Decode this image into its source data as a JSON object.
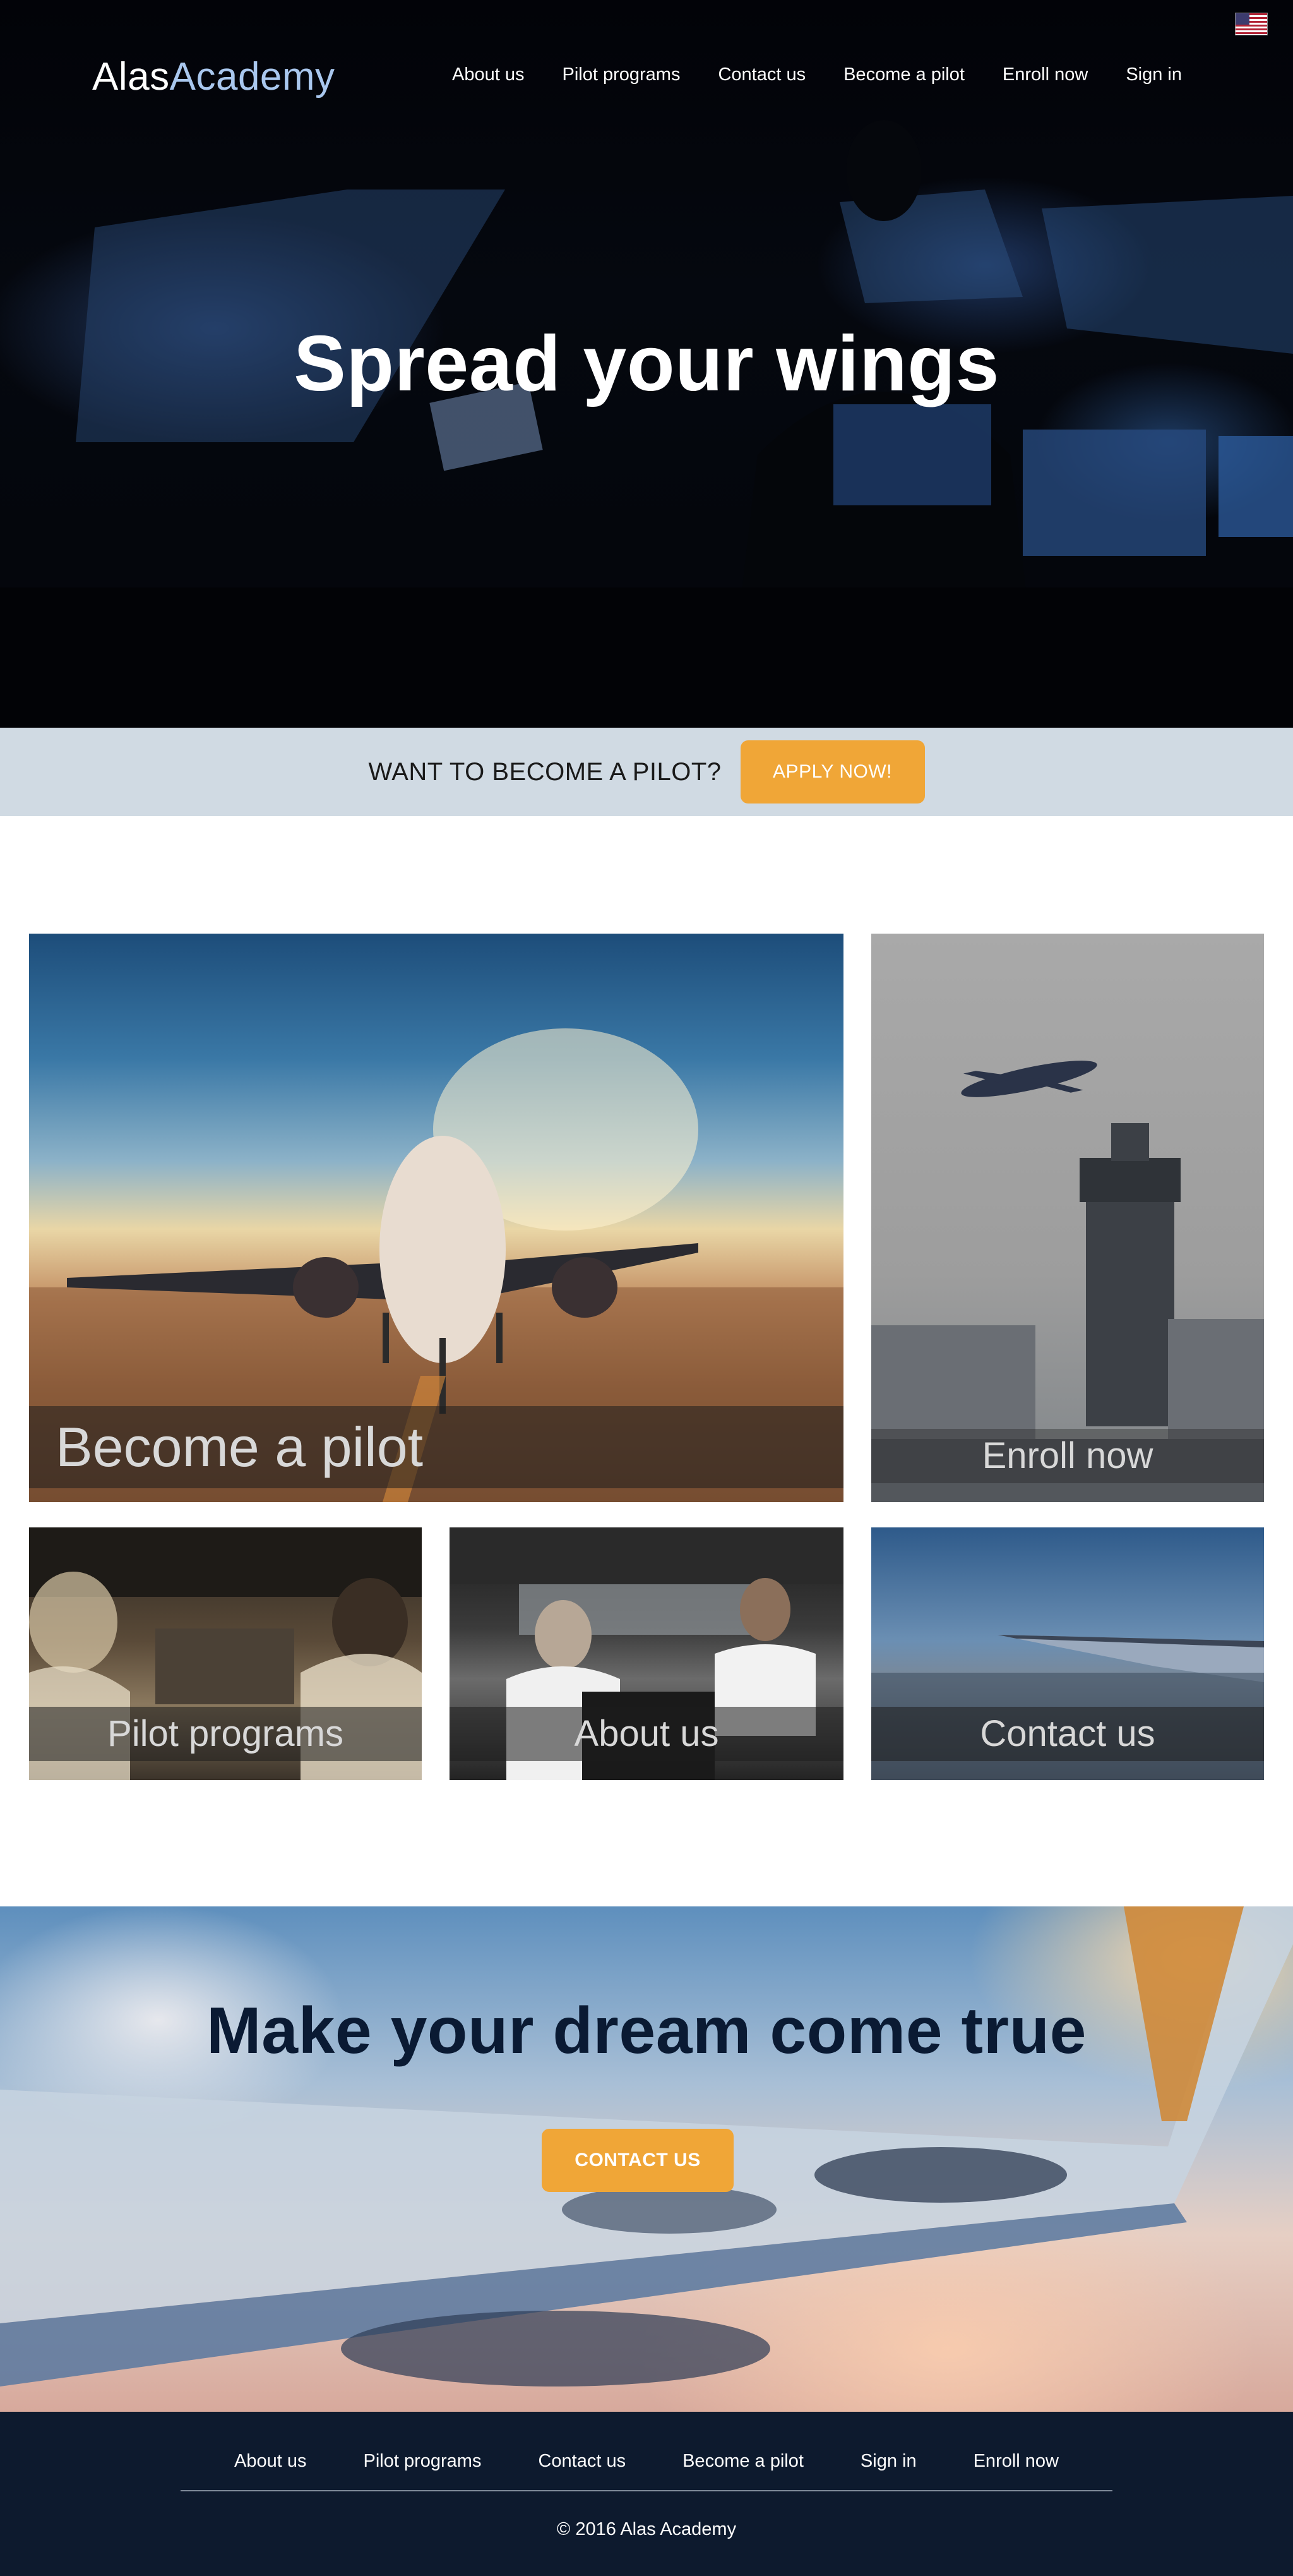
{
  "header": {
    "logo_part1": "Alas",
    "logo_part2": "Academy",
    "nav": [
      "About us",
      "Pilot programs",
      "Contact us",
      "Become a pilot",
      "Enroll now",
      "Sign in"
    ]
  },
  "hero": {
    "title": "Spread your wings"
  },
  "cta": {
    "text": "WANT TO BECOME A PILOT?",
    "button": "APPLY NOW!"
  },
  "tiles": {
    "become": "Become a pilot",
    "enroll": "Enroll now",
    "pilot_programs": "Pilot programs",
    "about": "About us",
    "contact": "Contact us"
  },
  "dream": {
    "title": "Make your dream come true",
    "button": "CONTACT US"
  },
  "footer": {
    "nav": [
      "About us",
      "Pilot programs",
      "Contact us",
      "Become a pilot",
      "Sign in",
      "Enroll now"
    ],
    "copyright": "© 2016 Alas Academy"
  },
  "icons": {
    "language": "us-flag-icon"
  },
  "colors": {
    "accent_orange": "#f0a637",
    "footer_bg": "#0d1a2e",
    "cta_strip_bg": "#d0dae3",
    "logo_accent": "#a9c7ee"
  }
}
